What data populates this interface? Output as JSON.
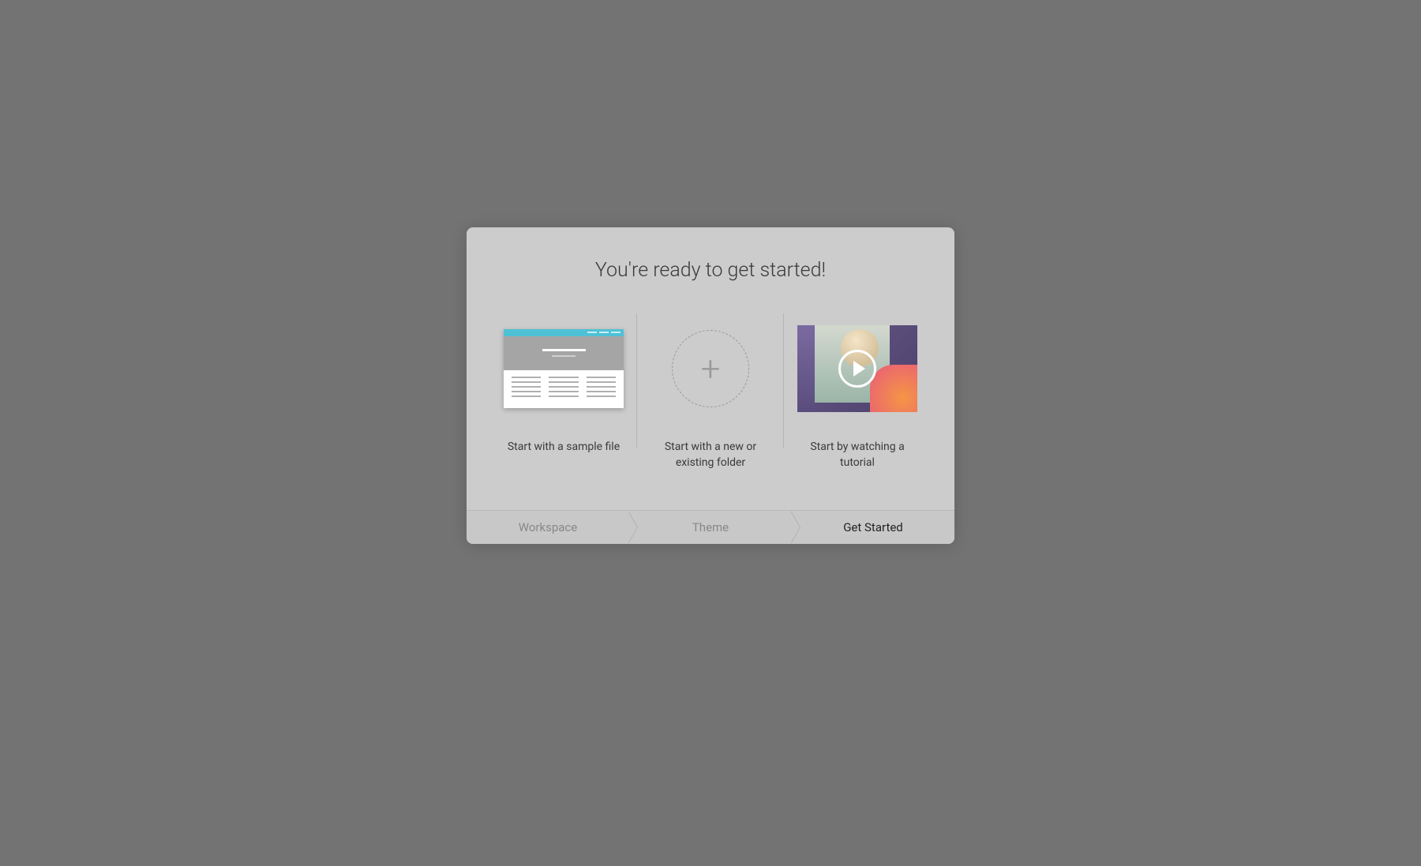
{
  "modal": {
    "title": "You're ready to get started!",
    "options": [
      {
        "label": "Start with a sample file"
      },
      {
        "label": "Start with a new or existing folder"
      },
      {
        "label": "Start by watching a tutorial"
      }
    ]
  },
  "stepper": {
    "steps": [
      {
        "label": "Workspace",
        "active": false
      },
      {
        "label": "Theme",
        "active": false
      },
      {
        "label": "Get Started",
        "active": true
      }
    ]
  }
}
